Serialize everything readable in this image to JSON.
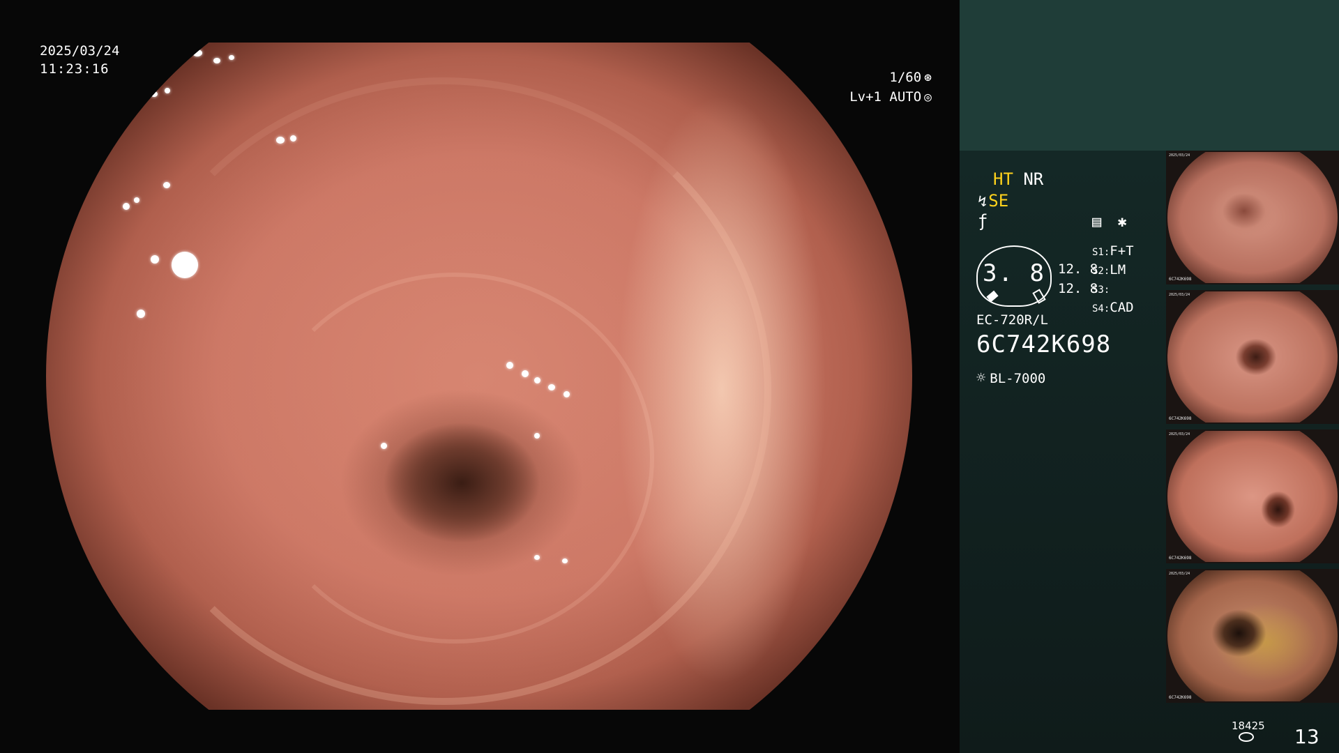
{
  "overlay": {
    "date": "2025/03/24",
    "time": "11:23:16",
    "shutter": "1/60",
    "shutter_icon": "shutter-icon",
    "level_auto": "Lv+1  AUTO",
    "auto_icon": "auto-iris-icon"
  },
  "panel": {
    "mode_ht": "HT",
    "mode_nr": "NR",
    "mode_se": "SE",
    "icons": {
      "se": "enhance-icon",
      "f": "freeze-icon",
      "settings": "menu-icon",
      "star": "star-icon",
      "light": "sun-icon"
    },
    "gauge_value": "3. 8",
    "zoom_values": [
      "12. 8",
      "12. 8"
    ],
    "switches": [
      {
        "key": "S1:",
        "value": "F+T"
      },
      {
        "key": "S2:",
        "value": "LM"
      },
      {
        "key": "S3:",
        "value": ""
      },
      {
        "key": "S4:",
        "value": "CAD"
      }
    ],
    "scope_model": "EC-720R/L",
    "scope_serial": "6C742K698",
    "light_source": "BL-7000"
  },
  "thumbnails": [
    {
      "caption": "6C742K698",
      "date": "2025/03/24"
    },
    {
      "caption": "6C742K698",
      "date": "2025/03/24"
    },
    {
      "caption": "6C742K698",
      "date": "2025/03/24"
    },
    {
      "caption": "6C742K698",
      "date": "2025/03/24"
    }
  ],
  "footer": {
    "frame_count": "18425",
    "page_number": "13"
  },
  "colors": {
    "accent_yellow": "#ffd21c",
    "panel_header": "#1f3d38",
    "panel_body": "#12201f"
  }
}
